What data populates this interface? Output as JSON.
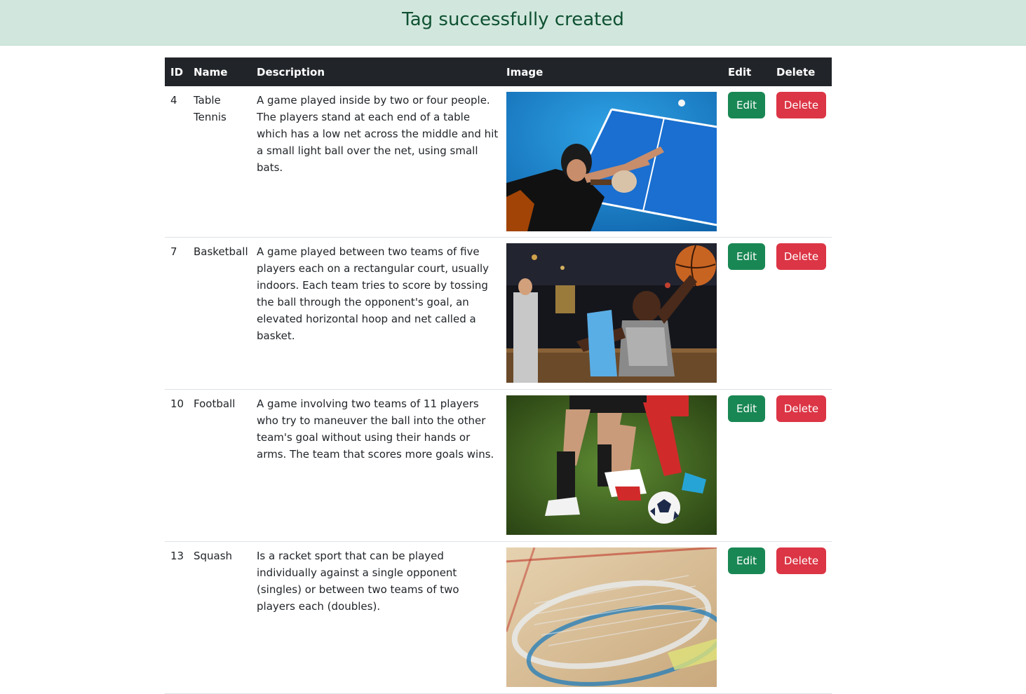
{
  "alert": {
    "message": "Tag successfully created"
  },
  "table": {
    "headers": {
      "id": "ID",
      "name": "Name",
      "description": "Description",
      "image": "Image",
      "edit": "Edit",
      "delete": "Delete"
    },
    "rows": [
      {
        "id": "4",
        "name": "Table Tennis",
        "description": "A game played inside by two or four people. The players stand at each end of a table which has a low net across the middle and hit a small light ball over the net, using small bats.",
        "image": "table-tennis-photo",
        "edit_label": "Edit",
        "delete_label": "Delete"
      },
      {
        "id": "7",
        "name": "Basketball",
        "description": "A game played between two teams of five players each on a rectangular court, usually indoors. Each team tries to score by tossing the ball through the opponent's goal, an elevated horizontal hoop and net called a basket.",
        "image": "basketball-photo",
        "edit_label": "Edit",
        "delete_label": "Delete"
      },
      {
        "id": "10",
        "name": "Football",
        "description": "A game involving two teams of 11 players who try to maneuver the ball into the other team's goal without using their hands or arms. The team that scores more goals wins.",
        "image": "football-photo",
        "edit_label": "Edit",
        "delete_label": "Delete"
      },
      {
        "id": "13",
        "name": "Squash",
        "description": "Is a racket sport that can be played individually against a single opponent (singles) or between two teams of two players each (doubles).",
        "image": "squash-photo",
        "edit_label": "Edit",
        "delete_label": "Delete"
      }
    ]
  },
  "colors": {
    "alert_bg": "#d1e7dd",
    "alert_text": "#0f5132",
    "header_bg": "#212529",
    "edit": "#198754",
    "delete": "#dc3545"
  }
}
